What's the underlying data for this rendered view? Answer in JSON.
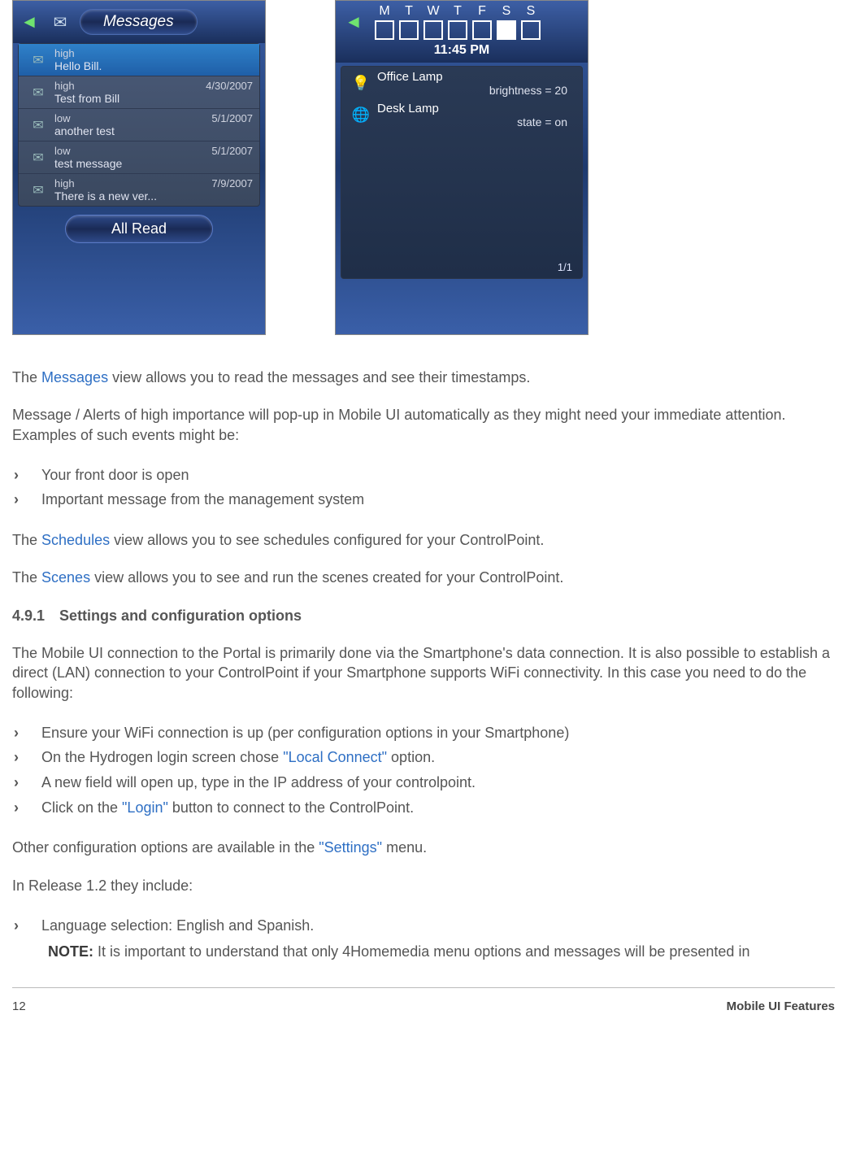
{
  "screenA": {
    "title": "Messages",
    "items": [
      {
        "priority": "high",
        "date": "",
        "body": "Hello Bill.",
        "highlighted": true
      },
      {
        "priority": "high",
        "date": "4/30/2007",
        "body": "Test from Bill",
        "highlighted": false
      },
      {
        "priority": "low",
        "date": "5/1/2007",
        "body": "another test",
        "highlighted": false
      },
      {
        "priority": "low",
        "date": "5/1/2007",
        "body": "test message",
        "highlighted": false
      },
      {
        "priority": "high",
        "date": "7/9/2007",
        "body": "There is a new ver...",
        "highlighted": false
      }
    ],
    "all_read_label": "All Read"
  },
  "screenB": {
    "days": [
      "M",
      "T",
      "W",
      "T",
      "F",
      "S",
      "S"
    ],
    "checked_index": 5,
    "time": "11:45 PM",
    "devices": [
      {
        "name": "Office Lamp",
        "state": "brightness = 20",
        "icon": "bulb-icon"
      },
      {
        "name": "Desk Lamp",
        "state": "state = on",
        "icon": "globe-icon"
      }
    ],
    "pager": "1/1"
  },
  "text": {
    "p1_pre": "The ",
    "p1_link": "Messages",
    "p1_post": " view allows you to read the messages and see their timestamps.",
    "p2": "Message / Alerts of high importance will pop-up in Mobile UI automatically as they might need your immediate attention. Examples of such events might be:",
    "list1": [
      "Your front door is open",
      "Important message from the management system"
    ],
    "p3_pre": "The ",
    "p3_link": "Schedules",
    "p3_post": " view allows you to see schedules configured for your ControlPoint.",
    "p4_pre": "The ",
    "p4_link": "Scenes",
    "p4_post": " view allows you to see and run the scenes created for your ControlPoint.",
    "section_num": "4.9.1",
    "section_title": "Settings and configuration options",
    "p5": "The Mobile UI connection to the Portal is primarily done via the Smartphone's data connection.  It is also possible to establish a direct (LAN) connection to your ControlPoint if your Smartphone supports WiFi connectivity. In this case you need to do the following:",
    "list2_a": "Ensure your WiFi connection is up (per configuration options in your Smartphone)",
    "list2_b_pre": "On the Hydrogen login screen chose ",
    "list2_b_link": "\"Local Connect\"",
    "list2_b_post": " option.",
    "list2_c": "A new field will open up, type in the IP address of your controlpoint.",
    "list2_d_pre": "Click on the ",
    "list2_d_link": "\"Login\"",
    "list2_d_post": " button to connect to the ControlPoint.",
    "p6_pre": "Other configuration options are available in the ",
    "p6_link": "\"Settings\"",
    "p6_post": " menu.",
    "p7": "In Release 1.2 they include:",
    "list3_a": "Language selection: English and Spanish.",
    "note_label": "NOTE:",
    "note_text": "  It is important to understand that only 4Homemedia menu options and messages will be presented in"
  },
  "footer": {
    "page_num": "12",
    "title": "Mobile UI Features"
  }
}
